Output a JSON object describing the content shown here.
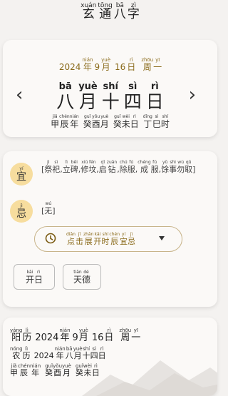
{
  "app_title": [
    {
      "py": "xuán",
      "hz": "玄"
    },
    {
      "py": "tōng",
      "hz": "通"
    },
    {
      "py": "bā",
      "hz": "八"
    },
    {
      "py": "zì",
      "hz": "字"
    }
  ],
  "date_header": {
    "year": "2024",
    "year_unit": {
      "py": "nián",
      "hz": "年"
    },
    "month": "9",
    "month_unit": {
      "py": "yuè",
      "hz": "月"
    },
    "day": "16",
    "day_unit": {
      "py": "rì",
      "hz": "日"
    },
    "weekday": [
      {
        "py": "zhōu",
        "hz": "周"
      },
      {
        "py": "yī",
        "hz": "一"
      }
    ]
  },
  "lunar_big": [
    {
      "py": "bā",
      "hz": "八"
    },
    {
      "py": "yuè",
      "hz": "月"
    },
    {
      "py": "shí",
      "hz": "十"
    },
    {
      "py": "sì",
      "hz": "四"
    },
    {
      "py": "rì",
      "hz": "日"
    }
  ],
  "nav": {
    "prev": "‹",
    "next": "›"
  },
  "ganzhi": [
    [
      {
        "py": "jiǎ",
        "hz": "甲"
      },
      {
        "py": "chén",
        "hz": "辰"
      },
      {
        "py": "nián",
        "hz": "年"
      }
    ],
    [
      {
        "py": "guǐ",
        "hz": "癸"
      },
      {
        "py": "yǒu",
        "hz": "酉"
      },
      {
        "py": "yuè",
        "hz": "月"
      }
    ],
    [
      {
        "py": "guǐ",
        "hz": "癸"
      },
      {
        "py": "wèi",
        "hz": "未"
      },
      {
        "py": "rì",
        "hz": "日"
      }
    ],
    [
      {
        "py": "dīng",
        "hz": "丁"
      },
      {
        "py": "sì",
        "hz": "巳"
      },
      {
        "py": "shí",
        "hz": "时"
      }
    ]
  ],
  "yi": {
    "badge": {
      "py": "yí",
      "hz": "宜"
    },
    "items": [
      {
        "py": "",
        "hz": "["
      },
      {
        "py": "jì",
        "hz": "祭"
      },
      {
        "py": "sì",
        "hz": "祀"
      },
      {
        "py": "",
        "hz": ","
      },
      {
        "py": "lì",
        "hz": "立"
      },
      {
        "py": "bēi",
        "hz": "碑"
      },
      {
        "py": "",
        "hz": ","
      },
      {
        "py": "xiū",
        "hz": "修"
      },
      {
        "py": "fén",
        "hz": "坟"
      },
      {
        "py": "",
        "hz": ","
      },
      {
        "py": "qǐ",
        "hz": "启"
      },
      {
        "py": "zuān",
        "hz": "钻"
      },
      {
        "py": "",
        "hz": ","
      },
      {
        "py": "chú",
        "hz": "除"
      },
      {
        "py": "fú",
        "hz": "服"
      },
      {
        "py": "",
        "hz": ","
      },
      {
        "py": "chéng",
        "hz": "成"
      },
      {
        "py": "fú",
        "hz": "服"
      },
      {
        "py": "",
        "hz": ","
      },
      {
        "py": "yǔ",
        "hz": "馀"
      },
      {
        "py": "shì",
        "hz": "事"
      },
      {
        "py": "wù",
        "hz": "勿"
      },
      {
        "py": "qǔ",
        "hz": "取"
      },
      {
        "py": "",
        "hz": "]"
      }
    ]
  },
  "ji": {
    "badge": {
      "py": "jì",
      "hz": "忌"
    },
    "items": [
      {
        "py": "",
        "hz": "["
      },
      {
        "py": "wú",
        "hz": "无"
      },
      {
        "py": "",
        "hz": "]"
      }
    ]
  },
  "hour_button": [
    {
      "py": "diǎn",
      "hz": "点"
    },
    {
      "py": "jī",
      "hz": "击"
    },
    {
      "py": "zhǎn",
      "hz": "展"
    },
    {
      "py": "kāi",
      "hz": "开"
    },
    {
      "py": "shí",
      "hz": "时"
    },
    {
      "py": "chén",
      "hz": "辰"
    },
    {
      "py": "yí",
      "hz": "宜"
    },
    {
      "py": "jì",
      "hz": "忌"
    }
  ],
  "buttons": {
    "kairi": [
      {
        "py": "kāi",
        "hz": "开"
      },
      {
        "py": "rì",
        "hz": "日"
      }
    ],
    "tiande": [
      {
        "py": "tiān",
        "hz": "天"
      },
      {
        "py": "dé",
        "hz": "德"
      }
    ]
  },
  "bottom": {
    "solar_label": [
      {
        "py": "yáng",
        "hz": "阳"
      },
      {
        "py": "lì",
        "hz": "历"
      }
    ],
    "solar": {
      "year": "2024",
      "year_unit": {
        "py": "nián",
        "hz": "年"
      },
      "month": "9",
      "month_unit": {
        "py": "yuè",
        "hz": "月"
      },
      "day": "16",
      "day_unit": {
        "py": "rì",
        "hz": "日"
      },
      "weekday": [
        {
          "py": "zhōu",
          "hz": "周"
        },
        {
          "py": "yī",
          "hz": "一"
        }
      ]
    },
    "lunar_label": [
      {
        "py": "nóng",
        "hz": "农"
      },
      {
        "py": "lì",
        "hz": "历"
      }
    ],
    "lunar": {
      "year": "2024",
      "rest": [
        {
          "py": "nián",
          "hz": "年"
        },
        {
          "py": "bā",
          "hz": "八"
        },
        {
          "py": "yuè",
          "hz": "月"
        },
        {
          "py": "shí",
          "hz": "十"
        },
        {
          "py": "sì",
          "hz": "四"
        },
        {
          "py": "rì",
          "hz": "日"
        }
      ]
    },
    "ganzhi": [
      [
        {
          "py": "jiǎ",
          "hz": "甲"
        },
        {
          "py": "chén",
          "hz": "辰"
        },
        {
          "py": "nián",
          "hz": "年"
        }
      ],
      [
        {
          "py": "guǐ",
          "hz": "癸"
        },
        {
          "py": "yǒu",
          "hz": "酉"
        },
        {
          "py": "yuè",
          "hz": "月"
        }
      ],
      [
        {
          "py": "guǐ",
          "hz": "癸"
        },
        {
          "py": "wèi",
          "hz": "未"
        },
        {
          "py": "rì",
          "hz": "日"
        }
      ]
    ]
  },
  "colors": {
    "accent": "#8a6a1a",
    "badge": "#f7dd9e",
    "card": "#fbf9f7",
    "background": "#f4f2f0"
  }
}
